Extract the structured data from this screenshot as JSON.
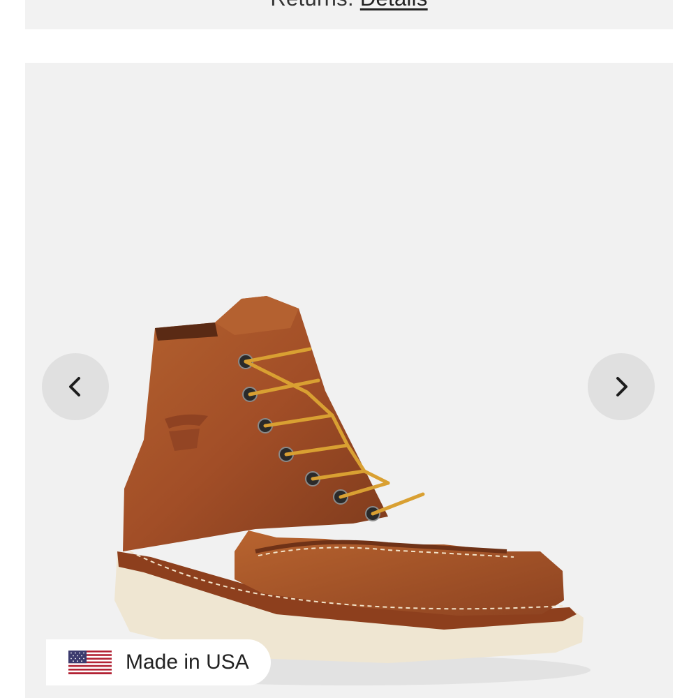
{
  "banner": {
    "prefix": "Returns.",
    "link_label": "Details"
  },
  "gallery": {
    "image_alt": "Leather moc toe boot",
    "prev_icon": "chevron-left-icon",
    "next_icon": "chevron-right-icon",
    "badge_icon": "us-flag-icon",
    "badge_label": "Made in USA"
  },
  "colors": {
    "page_background": "#ffffff",
    "banner_background": "#f2f2f2",
    "gallery_background": "#f1f1f1",
    "nav_button": "#e0e0e0",
    "boot_leather": "#a5502a",
    "boot_sole": "#efe6d2",
    "laces": "#d9a032"
  }
}
